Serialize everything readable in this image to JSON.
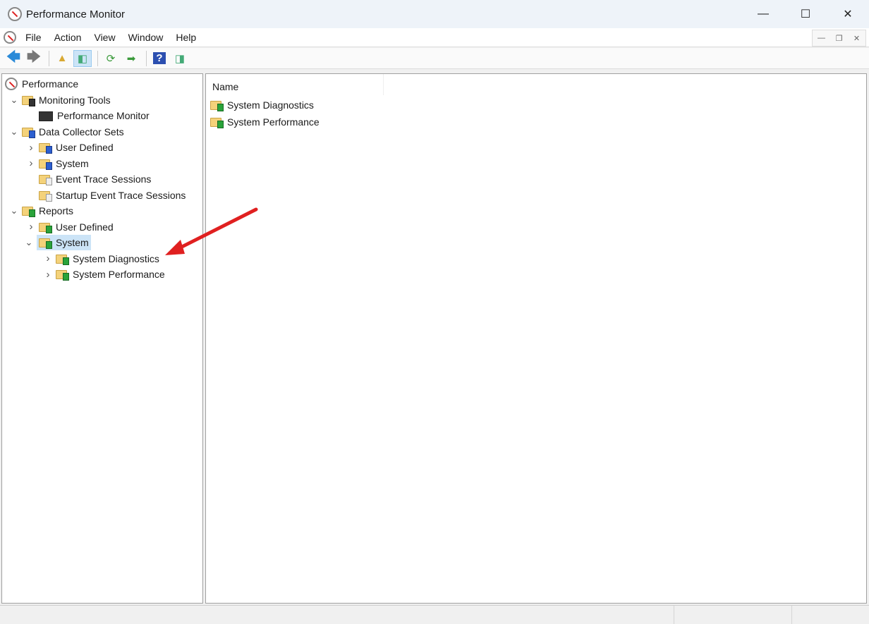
{
  "window": {
    "title": "Performance Monitor"
  },
  "menu": [
    "File",
    "Action",
    "View",
    "Window",
    "Help"
  ],
  "tree": [
    {
      "label": "Performance",
      "depth": 0,
      "icon": "perfmon",
      "chev": ""
    },
    {
      "label": "Monitoring Tools",
      "depth": 1,
      "icon": "folder-monitor",
      "chev": "v"
    },
    {
      "label": "Performance Monitor",
      "depth": 2,
      "icon": "monitor",
      "chev": ""
    },
    {
      "label": "Data Collector Sets",
      "depth": 1,
      "icon": "folder-blue",
      "chev": "v"
    },
    {
      "label": "User Defined",
      "depth": 2,
      "icon": "folder-user",
      "chev": ">"
    },
    {
      "label": "System",
      "depth": 2,
      "icon": "folder-blue",
      "chev": ">"
    },
    {
      "label": "Event Trace Sessions",
      "depth": 2,
      "icon": "folder-trace",
      "chev": ""
    },
    {
      "label": "Startup Event Trace Sessions",
      "depth": 2,
      "icon": "folder-trace",
      "chev": ""
    },
    {
      "label": "Reports",
      "depth": 1,
      "icon": "folder-report",
      "chev": "v"
    },
    {
      "label": "User Defined",
      "depth": 2,
      "icon": "report-user",
      "chev": ">"
    },
    {
      "label": "System",
      "depth": 2,
      "icon": "report-system",
      "chev": "v",
      "selected": true
    },
    {
      "label": "System Diagnostics",
      "depth": 3,
      "icon": "folder-report",
      "chev": ">"
    },
    {
      "label": "System Performance",
      "depth": 3,
      "icon": "folder-report",
      "chev": ">"
    }
  ],
  "list": {
    "column": "Name",
    "items": [
      "System Diagnostics",
      "System Performance"
    ]
  },
  "annotation": {
    "color": "#e02020"
  }
}
